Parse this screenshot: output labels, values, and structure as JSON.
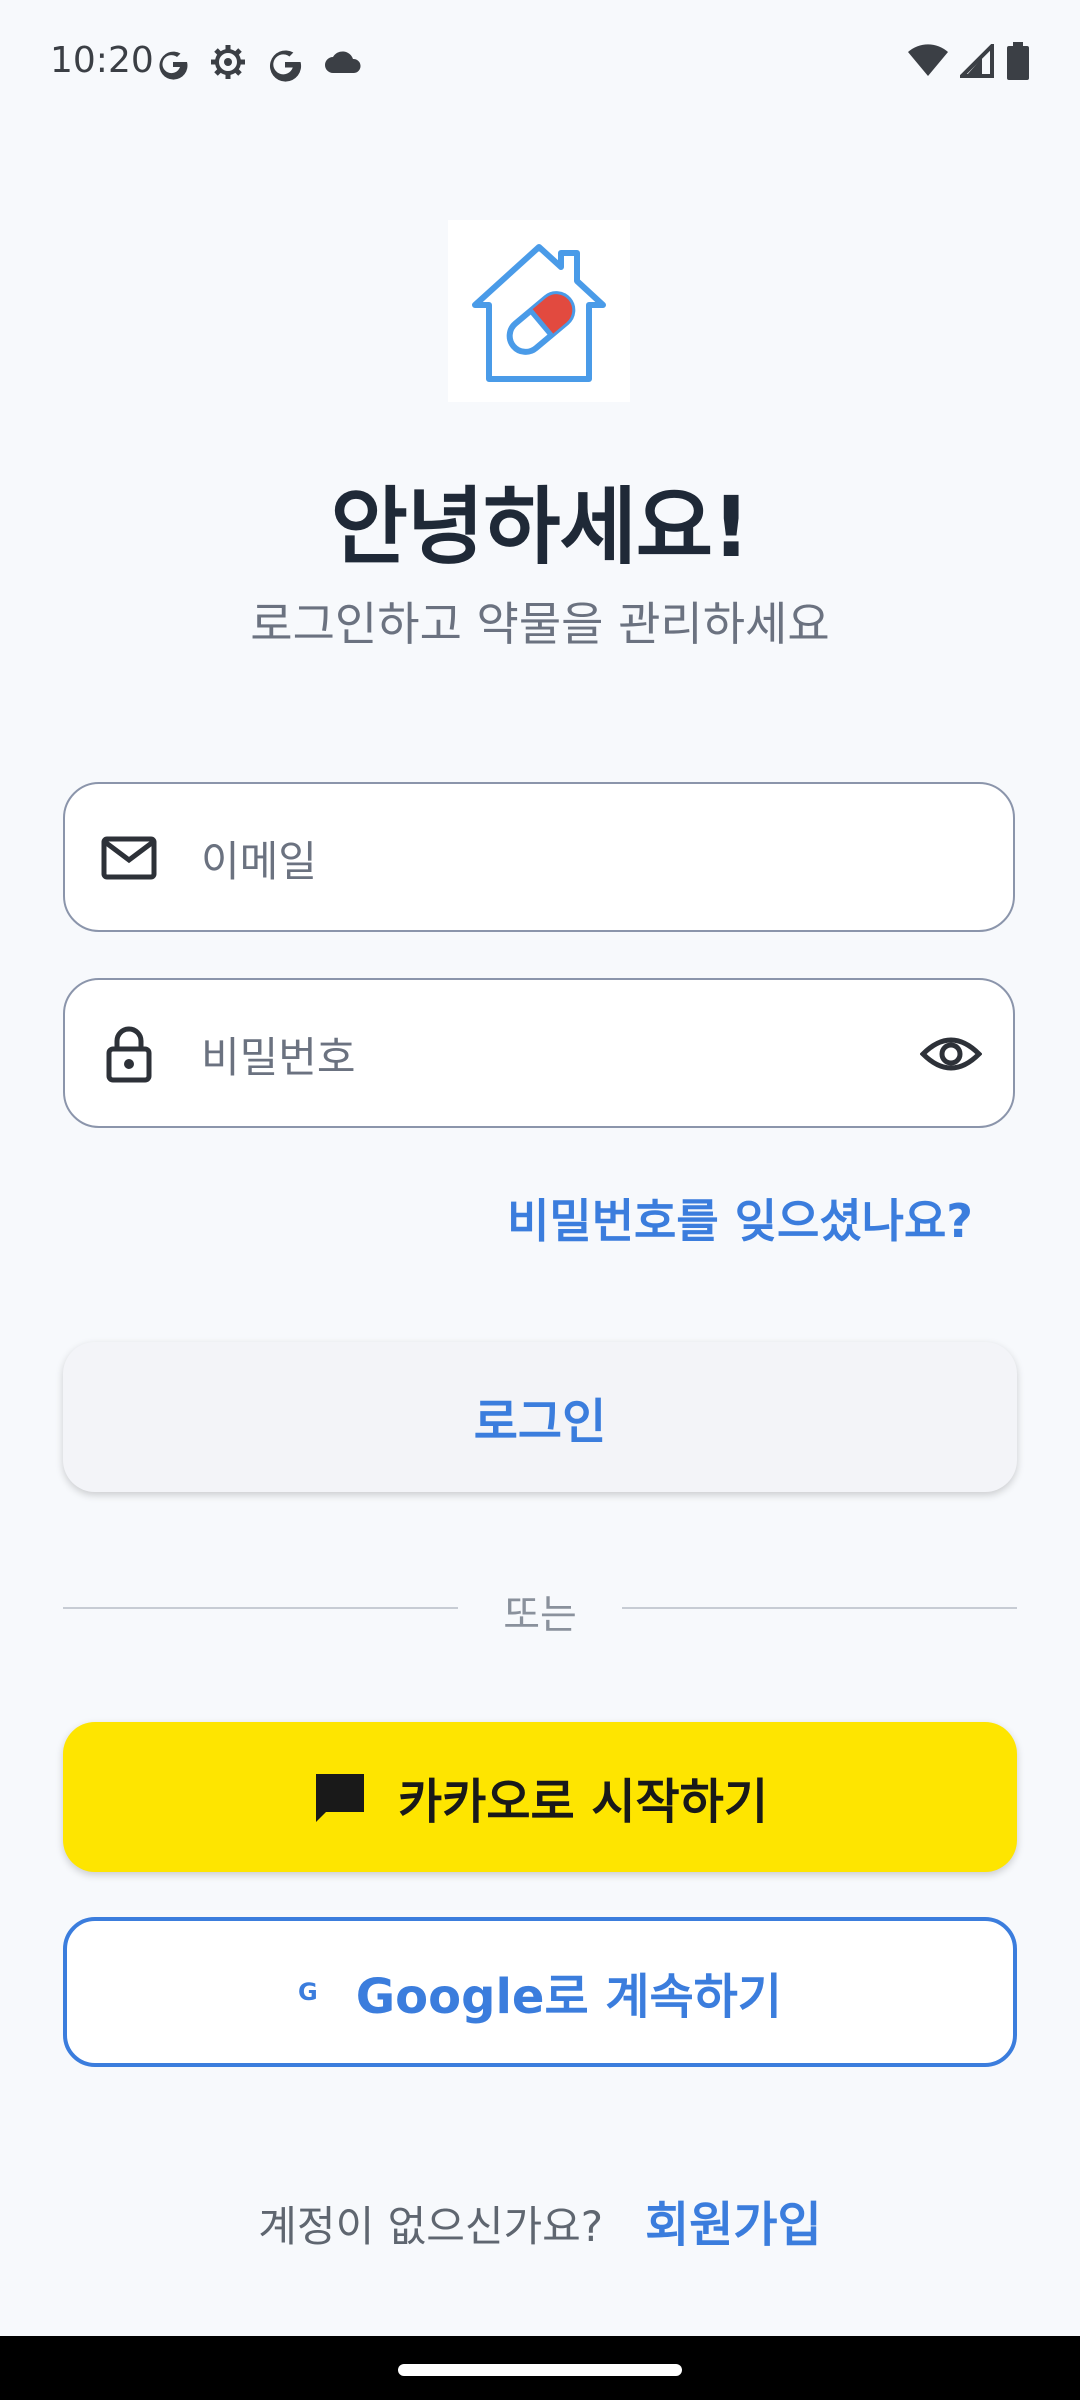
{
  "status_bar": {
    "time": "10:20",
    "left_icons": [
      "google-g-icon",
      "settings-gear-icon",
      "google-g-icon",
      "cloud-icon"
    ],
    "right_icons": [
      "wifi-icon",
      "cell-signal-icon",
      "battery-icon"
    ]
  },
  "header": {
    "logo_icon": "home-pill-icon",
    "title": "안녕하세요!",
    "subtitle": "로그인하고 약물을 관리하세요"
  },
  "form": {
    "email_placeholder": "이메일",
    "password_placeholder": "비밀번호",
    "forgot_password": "비밀번호를 잊으셨나요?",
    "login_label": "로그인"
  },
  "divider": {
    "label": "또는"
  },
  "social": {
    "kakao_label": "카카오로 시작하기",
    "google_mark": "G",
    "google_label": "Google로 계속하기"
  },
  "signup": {
    "prompt": "계정이 없으신가요?",
    "link": "회원가입"
  },
  "colors": {
    "accent": "#3b7ddd",
    "kakao": "#fee500",
    "background": "#f7f9fc"
  }
}
